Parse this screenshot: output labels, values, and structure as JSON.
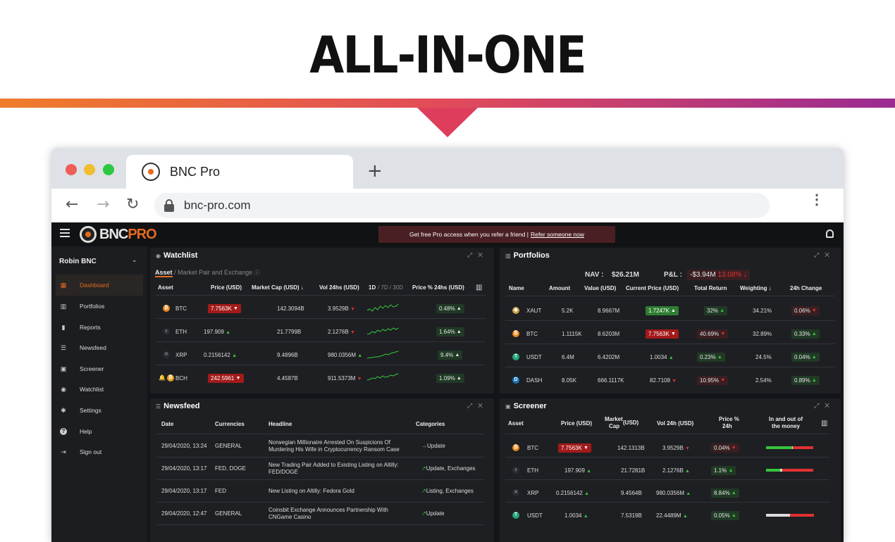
{
  "hero": {
    "title": "ALL-IN-ONE"
  },
  "browser": {
    "tab_title": "BNC Pro",
    "new_tab": "+",
    "url": "bnc-pro.com",
    "back": "←",
    "forward": "→",
    "reload": "↻",
    "menu": "⋮"
  },
  "topbar": {
    "logo_bnc": "BNC",
    "logo_pro": "PRO",
    "promo_text": "Get free Pro access when you refer a friend |",
    "promo_link": "Refer someone now"
  },
  "sidebar": {
    "user": "Robin BNC",
    "items": [
      {
        "label": "Dashboard",
        "icon": "grid-icon"
      },
      {
        "label": "Portfolios",
        "icon": "bar-chart-icon"
      },
      {
        "label": "Reports",
        "icon": "clipboard-icon"
      },
      {
        "label": "Newsfeed",
        "icon": "list-icon"
      },
      {
        "label": "Screener",
        "icon": "toolbox-icon"
      },
      {
        "label": "Watchlist",
        "icon": "eye-icon"
      },
      {
        "label": "Settings",
        "icon": "gear-icon"
      },
      {
        "label": "Help",
        "icon": "help-icon"
      },
      {
        "label": "Sign out",
        "icon": "sign-out-icon"
      }
    ]
  },
  "watchlist": {
    "title": "Watchlist",
    "tab_active": "Asset",
    "tab_rest": "/ Market Pair and Exchange",
    "headers": [
      "Asset",
      "Price (USD)",
      "Market Cap (USD) ↓",
      "Vol 24hs (USD)",
      "1D",
      "/ 7D / 30D",
      "Price % 24hs (USD)"
    ],
    "rows": [
      {
        "asset": "BTC",
        "price": "7.7563K",
        "price_dir": "down",
        "mcap": "142.3094B",
        "vol": "3.9529B",
        "vol_dir": "down",
        "pct": "0.48%",
        "pct_dir": "up"
      },
      {
        "asset": "ETH",
        "price": "197.909",
        "price_dir": "up",
        "mcap": "21.7799B",
        "vol": "2.1276B",
        "vol_dir": "down",
        "pct": "1.64%",
        "pct_dir": "up"
      },
      {
        "asset": "XRP",
        "price": "0.2156142",
        "price_dir": "up",
        "mcap": "9.4896B",
        "vol": "980.0356M",
        "vol_dir": "up",
        "pct": "9.4%",
        "pct_dir": "up"
      },
      {
        "asset": "BCH",
        "price": "242.5961",
        "price_dir": "down",
        "mcap": "4.4587B",
        "vol": "911.5373M",
        "vol_dir": "down",
        "pct": "1.09%",
        "pct_dir": "up"
      }
    ]
  },
  "portfolios": {
    "title": "Portfolios",
    "nav_label": "NAV :",
    "nav_value": "$26.21M",
    "pl_label": "P&L :",
    "pl_value": "-$3.94M",
    "pl_pct": "13.08%",
    "headers": [
      "Name",
      "Amount",
      "Value (USD)",
      "Current Price (USD)",
      "Total Return",
      "Weighting ↓",
      "24h Change"
    ],
    "rows": [
      {
        "name": "XAUT",
        "amount": "5.2K",
        "value": "8.9667M",
        "price": "1.7247K",
        "price_style": "green",
        "ret": "32%",
        "ret_dir": "up",
        "weight": "34.21%",
        "chg": "0.06%",
        "chg_dir": "down"
      },
      {
        "name": "BTC",
        "amount": "1.1115K",
        "value": "8.6203M",
        "price": "7.7563K",
        "price_style": "red",
        "ret": "40.69%",
        "ret_dir": "down",
        "weight": "32.89%",
        "chg": "0.33%",
        "chg_dir": "up"
      },
      {
        "name": "USDT",
        "amount": "6.4M",
        "value": "6.4202M",
        "price": "1.0034",
        "price_style": "up",
        "ret": "0.23%",
        "ret_dir": "up",
        "weight": "24.5%",
        "chg": "0.04%",
        "chg_dir": "up"
      },
      {
        "name": "DASH",
        "amount": "8.05K",
        "value": "666.1117K",
        "price": "82.7108",
        "price_style": "down",
        "ret": "10.95%",
        "ret_dir": "down",
        "weight": "2.54%",
        "chg": "0.89%",
        "chg_dir": "up"
      }
    ]
  },
  "newsfeed": {
    "title": "Newsfeed",
    "headers": [
      "Date",
      "Currencies",
      "Headline",
      "Categories"
    ],
    "rows": [
      {
        "date": "29/04/2020, 13:24",
        "cur": "GENERAL",
        "h1": "Norwegian Millionaire Arrested On Suspicions Of",
        "h2": "Murdering His Wife in Cryptocurrency Ransom Case",
        "cat": "Update",
        "cat_icon": "arrow-right-icon"
      },
      {
        "date": "29/04/2020, 13:17",
        "cur": "FED, DOGE",
        "h1": "New Trading Pair Added to Existing Listing on Altilly:",
        "h2": "FED/DOGE",
        "cat": "Update, Exchanges",
        "cat_icon": "trend-up-icon"
      },
      {
        "date": "29/04/2020, 13:17",
        "cur": "FED",
        "h1": "New Listing on Altilly: Fedora Gold",
        "h2": "",
        "cat": "Listing, Exchanges",
        "cat_icon": "trend-up-icon"
      },
      {
        "date": "29/04/2020, 12:47",
        "cur": "GENERAL",
        "h1": "Coinsbit Exchange Announces Partnership With",
        "h2": "CNGame Casino",
        "cat": "Update",
        "cat_icon": "trend-up-icon"
      }
    ]
  },
  "screener": {
    "title": "Screener",
    "headers": [
      "Asset",
      "Price (USD)",
      "Market",
      "Cap",
      "(USD)",
      "Vol 24h (USD)",
      "Price %",
      "24h",
      "In and out of",
      "the money"
    ],
    "rows": [
      {
        "asset": "BTC",
        "price": "7.7563K",
        "price_style": "red",
        "mcap": "142.1313B",
        "vol": "3.9529B",
        "vol_dir": "down",
        "pct": "0.04%",
        "pct_dir": "down",
        "bar": [
          0.55,
          0.02,
          0.3
        ]
      },
      {
        "asset": "ETH",
        "price": "197.909",
        "price_style": "up",
        "mcap": "21.7281B",
        "vol": "2.1276B",
        "vol_dir": "up",
        "pct": "1.1%",
        "pct_dir": "up",
        "bar": [
          0.3,
          0.05,
          0.55
        ]
      },
      {
        "asset": "XRP",
        "price": "0.2156142",
        "price_style": "up",
        "mcap": "9.4564B",
        "vol": "980.0356M",
        "vol_dir": "up",
        "pct": "8.84%",
        "pct_dir": "up",
        "bar": null
      },
      {
        "asset": "USDT",
        "price": "1.0034",
        "price_style": "up",
        "mcap": "7.5319B",
        "vol": "22.4489M",
        "vol_dir": "up",
        "pct": "0.05%",
        "pct_dir": "up",
        "bar": [
          0.0,
          0.5,
          0.3
        ]
      }
    ]
  },
  "colors": {
    "accent": "#e66a1f",
    "green": "#35c43c",
    "red": "#e03131"
  }
}
